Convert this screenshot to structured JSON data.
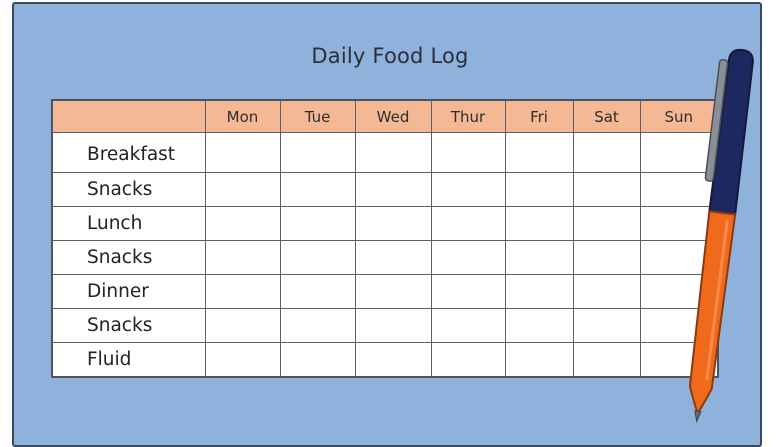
{
  "title": "Daily Food Log",
  "table": {
    "columns": [
      "Mon",
      "Tue",
      "Wed",
      "Thur",
      "Fri",
      "Sat",
      "Sun"
    ],
    "rows": [
      "Breakfast",
      "Snacks",
      "Lunch",
      "Snacks",
      "Dinner",
      "Snacks",
      "Fluid"
    ]
  },
  "colors": {
    "background": "#8fb2dc",
    "header": "#f4b894",
    "pen_barrel": "#f06a1e",
    "pen_cap": "#1e2860",
    "pen_clip": "#8a8f97"
  }
}
